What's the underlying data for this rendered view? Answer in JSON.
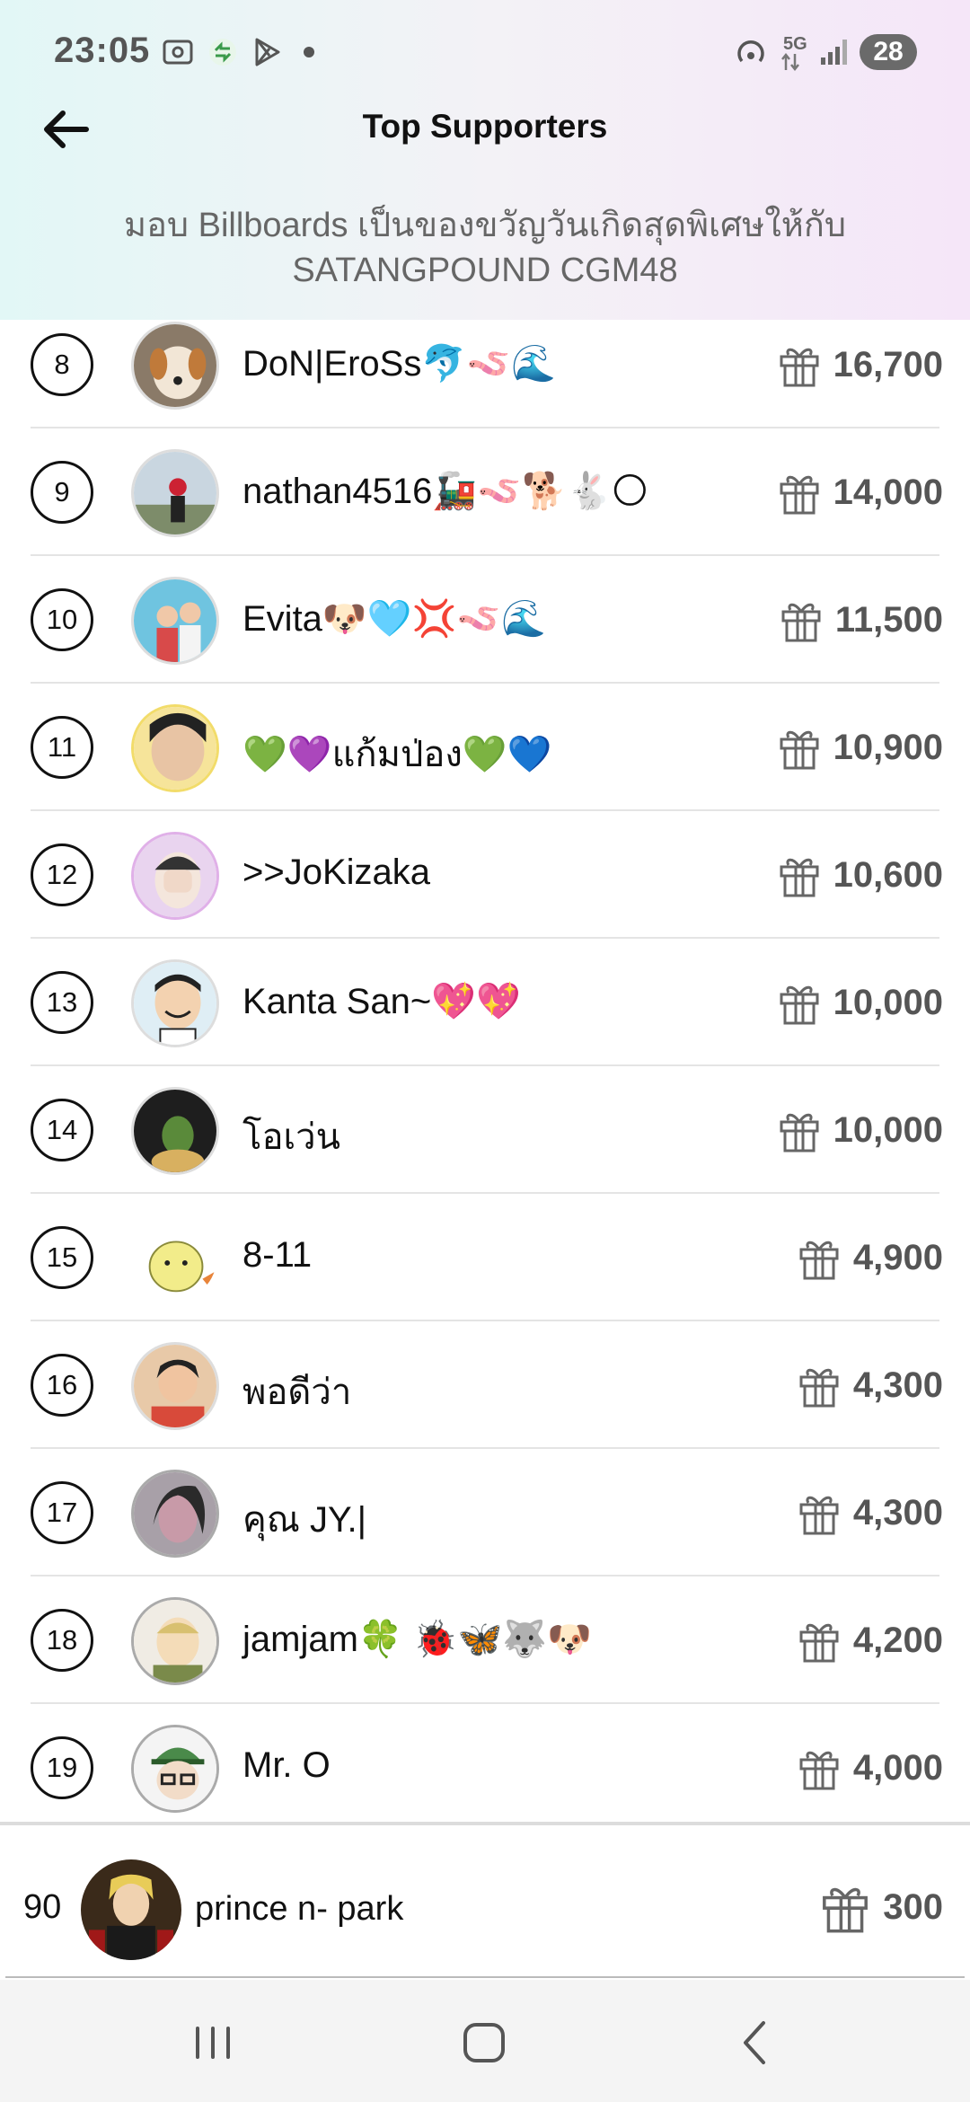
{
  "status_bar": {
    "time": "23:05",
    "network": "5G",
    "battery": "28"
  },
  "header": {
    "title": "Top Supporters",
    "subtitle": "มอบ  Billboards เป็นของขวัญวันเกิดสุดพิเศษให้กับ SATANGPOUND CGM48"
  },
  "supporters": [
    {
      "rank": "8",
      "name": "DoN|EroSs🐬🪱🌊",
      "amount": "16,700"
    },
    {
      "rank": "9",
      "name": "nathan4516🚂🪱🐕🐇🌕",
      "amount": "14,000"
    },
    {
      "rank": "10",
      "name": "Evita🐶🩵💢🪱🌊",
      "amount": "11,500"
    },
    {
      "rank": "11",
      "name": "💚💜แก้มป่อง💚💙",
      "amount": "10,900"
    },
    {
      "rank": "12",
      "name": ">>JoKizaka",
      "amount": "10,600"
    },
    {
      "rank": "13",
      "name": "Kanta San~💖💖",
      "amount": "10,000"
    },
    {
      "rank": "14",
      "name": "โอเว่น",
      "amount": "10,000"
    },
    {
      "rank": "15",
      "name": "8-11",
      "amount": "4,900"
    },
    {
      "rank": "16",
      "name": "พอดีว่า",
      "amount": "4,300"
    },
    {
      "rank": "17",
      "name": "คุณ JY.|",
      "amount": "4,300"
    },
    {
      "rank": "18",
      "name": "jamjam🍀 🐞🦋🐺🐶",
      "amount": "4,200"
    },
    {
      "rank": "19",
      "name": "Mr. O",
      "amount": "4,000"
    }
  ],
  "my_entry": {
    "rank": "90",
    "name": "prince n- park",
    "amount": "300"
  },
  "colors": {
    "header_left": "#e2f7f6",
    "header_right": "#f5e6f8",
    "amount_text": "#555555"
  },
  "icons": {
    "back": "arrow-left-icon",
    "gift": "gift-icon",
    "nav": [
      "recent-apps-icon",
      "home-icon",
      "back-chevron-icon"
    ]
  }
}
